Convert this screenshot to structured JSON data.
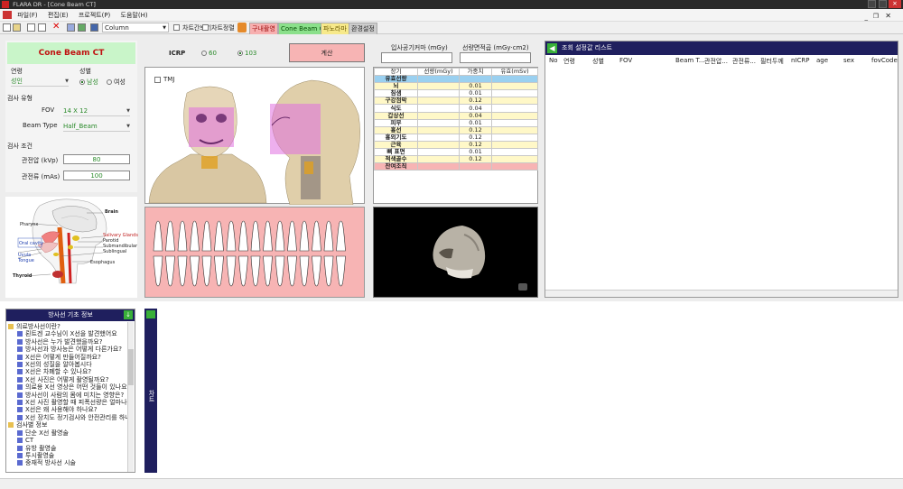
{
  "window": {
    "title": "FLARA DR - [Cone Beam CT]"
  },
  "menu": [
    "파일(F)",
    "편집(E)",
    "프로젝트(P)",
    "도움말(H)"
  ],
  "toolbar": {
    "column_value": "Column",
    "chk_chart_show": "차트간보기",
    "chk_chart_sort": "차트정렬",
    "tab_intraoral": "구내촬영",
    "tab_cbct": "Cone Beam CT",
    "tab_panorama": "파노라마",
    "tab_settings": "환경설정"
  },
  "left": {
    "title": "Cone Beam CT",
    "age_label": "연령",
    "age_value": "성인",
    "sex_label": "성별",
    "male": "남성",
    "female": "여성",
    "exam_type_label": "검사 유형",
    "fov_label": "FOV",
    "fov_value": "14 X 12",
    "beam_label": "Beam Type",
    "beam_value": "Half_Beam",
    "exam_cond_label": "검사 조건",
    "kvp_label": "관전압 (kVp)",
    "kvp_value": "80",
    "mas_label": "관전류 (mAs)",
    "mas_value": "100"
  },
  "anatomy": {
    "labels": [
      "Brain",
      "Pharynx",
      "Salivary Glands",
      "Parotid",
      "Submandibular",
      "Sublingual",
      "Oral cavity",
      "Uvula",
      "Tongue",
      "Esophagus",
      "Thyroid"
    ]
  },
  "icrp": {
    "label": "ICRP",
    "opt60": "60",
    "opt103": "103",
    "calc_button": "계산",
    "tmj": "TMJ"
  },
  "dose": {
    "entrance_label": "입사공기커마 (mGy)",
    "dap_label": "선량면적곱 (mGy·cm2)",
    "headers": [
      "장기",
      "선량(mGy)",
      "가중치",
      "유효(mSv)"
    ],
    "rows": [
      [
        "유효선량",
        "",
        "",
        ""
      ],
      [
        "뇌",
        "",
        "0.01",
        ""
      ],
      [
        "침샘",
        "",
        "0.01",
        ""
      ],
      [
        "구강점막",
        "",
        "0.12",
        ""
      ],
      [
        "식도",
        "",
        "0.04",
        ""
      ],
      [
        "갑상선",
        "",
        "0.04",
        ""
      ],
      [
        "피부",
        "",
        "0.01",
        ""
      ],
      [
        "흉선",
        "",
        "0.12",
        ""
      ],
      [
        "흉외기도",
        "",
        "0.12",
        ""
      ],
      [
        "근육",
        "",
        "0.12",
        ""
      ],
      [
        "뼈 표면",
        "",
        "0.01",
        ""
      ],
      [
        "적색골수",
        "",
        "0.12",
        ""
      ],
      [
        "잔여조직",
        "",
        "",
        ""
      ]
    ]
  },
  "right": {
    "title": "조회 설정값 리스트",
    "columns": [
      "No",
      "연령",
      "성별",
      "FOV",
      "Beam T...",
      "관전압...",
      "관전류...",
      "필터두께",
      "nICRP",
      "age",
      "sex",
      "fovCode"
    ]
  },
  "info": {
    "title": "방사선 기초 정보",
    "items": [
      {
        "text": "의료방사선이란?",
        "level": 0,
        "type": "folder"
      },
      {
        "text": "뢴트겐 교수님이 X선을 발견했어요",
        "level": 1,
        "type": "doc"
      },
      {
        "text": "방사선은 누가 발견했을까요?",
        "level": 1,
        "type": "doc"
      },
      {
        "text": "방사선과 방사능은 어떻게 다른가요?",
        "level": 1,
        "type": "doc"
      },
      {
        "text": "X선은 어떻게 만들어질까요?",
        "level": 1,
        "type": "doc"
      },
      {
        "text": "X선의 성질을 알아봅시다",
        "level": 1,
        "type": "doc"
      },
      {
        "text": "X선은 차폐할 수 있나요?",
        "level": 1,
        "type": "doc"
      },
      {
        "text": "X선 사진은 어떻게 촬영될까요?",
        "level": 1,
        "type": "doc"
      },
      {
        "text": "의료용 X선 영상은 어떤 것들이 있나요?",
        "level": 1,
        "type": "doc"
      },
      {
        "text": "방사선이 사람의 몸에 미치는 영향은?",
        "level": 1,
        "type": "doc"
      },
      {
        "text": "X선 사진 촬영할 때 피폭선량은 얼마나",
        "level": 1,
        "type": "doc"
      },
      {
        "text": "X선은 왜 사용해야 하나요?",
        "level": 1,
        "type": "doc"
      },
      {
        "text": "X선 장치도 정기검사와 안전관리를 하나",
        "level": 1,
        "type": "doc"
      },
      {
        "text": "검사별 정보",
        "level": 0,
        "type": "folder"
      },
      {
        "text": "단순 X선 촬영술",
        "level": 1,
        "type": "doc"
      },
      {
        "text": "CT",
        "level": 1,
        "type": "doc"
      },
      {
        "text": "유방 촬영술",
        "level": 1,
        "type": "doc"
      },
      {
        "text": "투시촬영술",
        "level": 1,
        "type": "doc"
      },
      {
        "text": "중재적 방사선 시술",
        "level": 1,
        "type": "doc"
      }
    ]
  },
  "chart_tab": {
    "label": "차트"
  },
  "colors": {
    "accent": "#00a000",
    "dark_header": "#1f1f5e",
    "pink": "#f5b5b5",
    "green_panel": "#c8f5c8"
  }
}
